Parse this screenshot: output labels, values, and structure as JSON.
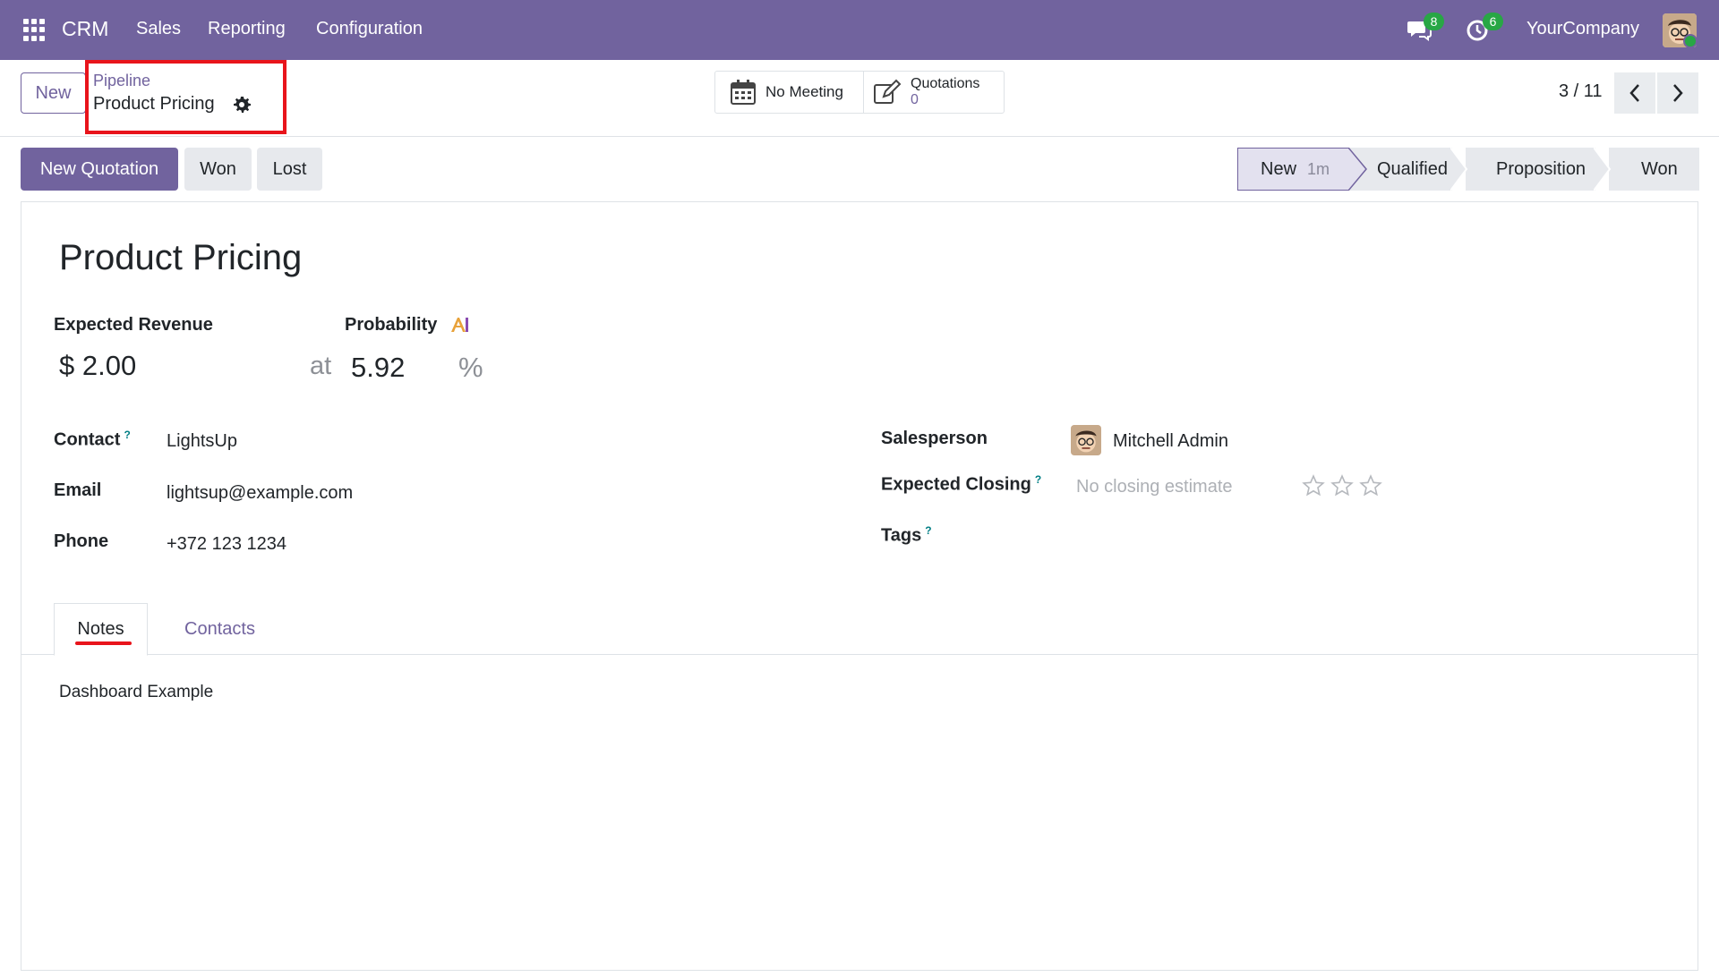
{
  "navbar": {
    "brand": "CRM",
    "menus": [
      "Sales",
      "Reporting",
      "Configuration"
    ],
    "messages_count": "8",
    "activities_count": "6",
    "company": "YourCompany"
  },
  "control": {
    "new_label": "New",
    "breadcrumb_parent": "Pipeline",
    "breadcrumb_current": "Product Pricing",
    "meeting_label": "No Meeting",
    "quotations_label": "Quotations",
    "quotations_count": "0",
    "pager": "3 / 11"
  },
  "actions": {
    "new_quotation": "New Quotation",
    "won": "Won",
    "lost": "Lost"
  },
  "stages": {
    "items": [
      "New",
      "Qualified",
      "Proposition",
      "Won"
    ],
    "current_duration": "1m"
  },
  "form": {
    "title": "Product Pricing",
    "expected_revenue_label": "Expected Revenue",
    "expected_revenue": "$ 2.00",
    "probability_label": "Probability",
    "at": "at",
    "probability": "5.92",
    "percent": "%",
    "contact_label": "Contact",
    "contact": "LightsUp",
    "email_label": "Email",
    "email": "lightsup@example.com",
    "phone_label": "Phone",
    "phone": "+372 123 1234",
    "salesperson_label": "Salesperson",
    "salesperson": "Mitchell Admin",
    "expected_closing_label": "Expected Closing",
    "expected_closing_placeholder": "No closing estimate",
    "tags_label": "Tags",
    "help_mark": "?",
    "priority_stars": 0
  },
  "tabs": {
    "notes": "Notes",
    "contacts": "Contacts"
  },
  "notes": {
    "text": "Dashboard Example"
  },
  "colors": {
    "brand": "#71639e",
    "highlight": "#e8141b",
    "badge": "#28a745"
  }
}
